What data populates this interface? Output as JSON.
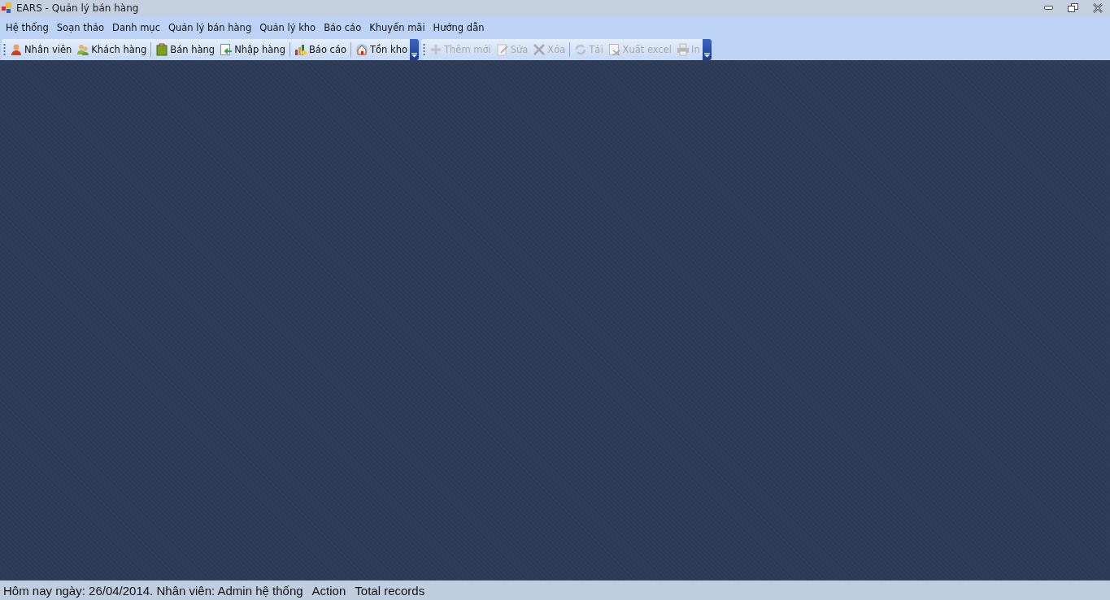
{
  "window": {
    "title": "EARS - Quản lý bán hàng"
  },
  "menu": [
    "Hệ thống",
    "Soạn thảo",
    "Danh mục",
    "Quản lý bán hàng",
    "Quản lý kho",
    "Báo cáo",
    "Khuyến mãi",
    "Hướng dẫn"
  ],
  "toolbars": [
    {
      "items": [
        {
          "kind": "button",
          "label": "Nhân viên",
          "disabled": false
        },
        {
          "kind": "button",
          "label": "Khách hàng",
          "disabled": false
        },
        {
          "kind": "separator"
        },
        {
          "kind": "button",
          "label": "Bán hàng",
          "disabled": false
        },
        {
          "kind": "button",
          "label": "Nhập hàng",
          "disabled": false
        },
        {
          "kind": "separator"
        },
        {
          "kind": "button",
          "label": "Báo cáo",
          "disabled": false
        },
        {
          "kind": "separator"
        },
        {
          "kind": "button",
          "label": "Tồn kho",
          "disabled": false
        }
      ]
    },
    {
      "items": [
        {
          "kind": "button",
          "label": "Thêm mới",
          "disabled": true
        },
        {
          "kind": "button",
          "label": "Sửa",
          "disabled": true
        },
        {
          "kind": "button",
          "label": "Xóa",
          "disabled": true
        },
        {
          "kind": "separator"
        },
        {
          "kind": "button",
          "label": "Tải",
          "disabled": true
        },
        {
          "kind": "button",
          "label": "Xuất excel",
          "disabled": true
        },
        {
          "kind": "button",
          "label": "In",
          "disabled": true
        }
      ]
    }
  ],
  "status_bar": [
    "Hôm nay ngày: 26/04/2014. Nhân viên: Admin hệ thống",
    "Action",
    "Total records"
  ]
}
